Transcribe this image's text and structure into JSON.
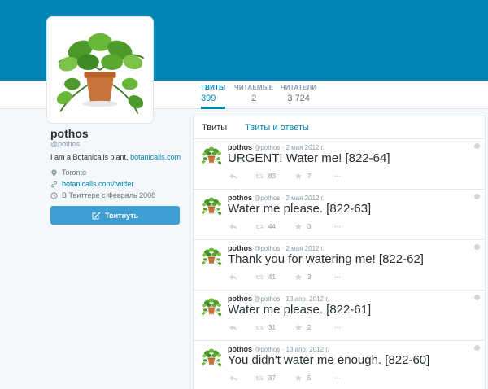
{
  "profile": {
    "name": "pothos",
    "handle": "@pothos",
    "bio_text": "I am a Botanicalls plant.",
    "bio_link": "botanicalls.com",
    "location": "Toronto",
    "website": "botanicalls.com/twitter",
    "joined": "В Твиттере с Февраль 2008",
    "tweet_button": "Твитнуть"
  },
  "stats": [
    {
      "label": "ТВИТЫ",
      "value": "399"
    },
    {
      "label": "ЧИТАЕМЫЕ",
      "value": "2"
    },
    {
      "label": "ЧИТАТЕЛИ",
      "value": "3 724"
    }
  ],
  "timeline": {
    "tabs": [
      "Твиты",
      "Твиты и ответы"
    ],
    "tweets": [
      {
        "name": "pothos",
        "handle": "@pothos",
        "date": "2 мая 2012 г.",
        "text": "URGENT! Water me! [822-64]",
        "retweets": "83",
        "favorites": "7"
      },
      {
        "name": "pothos",
        "handle": "@pothos",
        "date": "2 мая 2012 г.",
        "text": "Water me please. [822-63]",
        "retweets": "44",
        "favorites": "3"
      },
      {
        "name": "pothos",
        "handle": "@pothos",
        "date": "2 мая 2012 г.",
        "text": "Thank you for watering me! [822-62]",
        "retweets": "41",
        "favorites": "3"
      },
      {
        "name": "pothos",
        "handle": "@pothos",
        "date": "13 апр. 2012 г.",
        "text": "Water me please. [822-61]",
        "retweets": "31",
        "favorites": "2"
      },
      {
        "name": "pothos",
        "handle": "@pothos",
        "date": "13 апр. 2012 г.",
        "text": "You didn't water me enough. [822-60]",
        "retweets": "37",
        "favorites": "5"
      }
    ]
  },
  "icons": {
    "location": "map-pin-icon",
    "website": "link-icon",
    "joined": "calendar-icon",
    "compose": "compose-icon",
    "reply": "reply-icon",
    "retweet": "retweet-icon",
    "favorite": "star-icon",
    "more": "more-icon"
  },
  "colors": {
    "banner": "#0084b4",
    "link": "#0084b4",
    "button": "#3d9ed3"
  }
}
